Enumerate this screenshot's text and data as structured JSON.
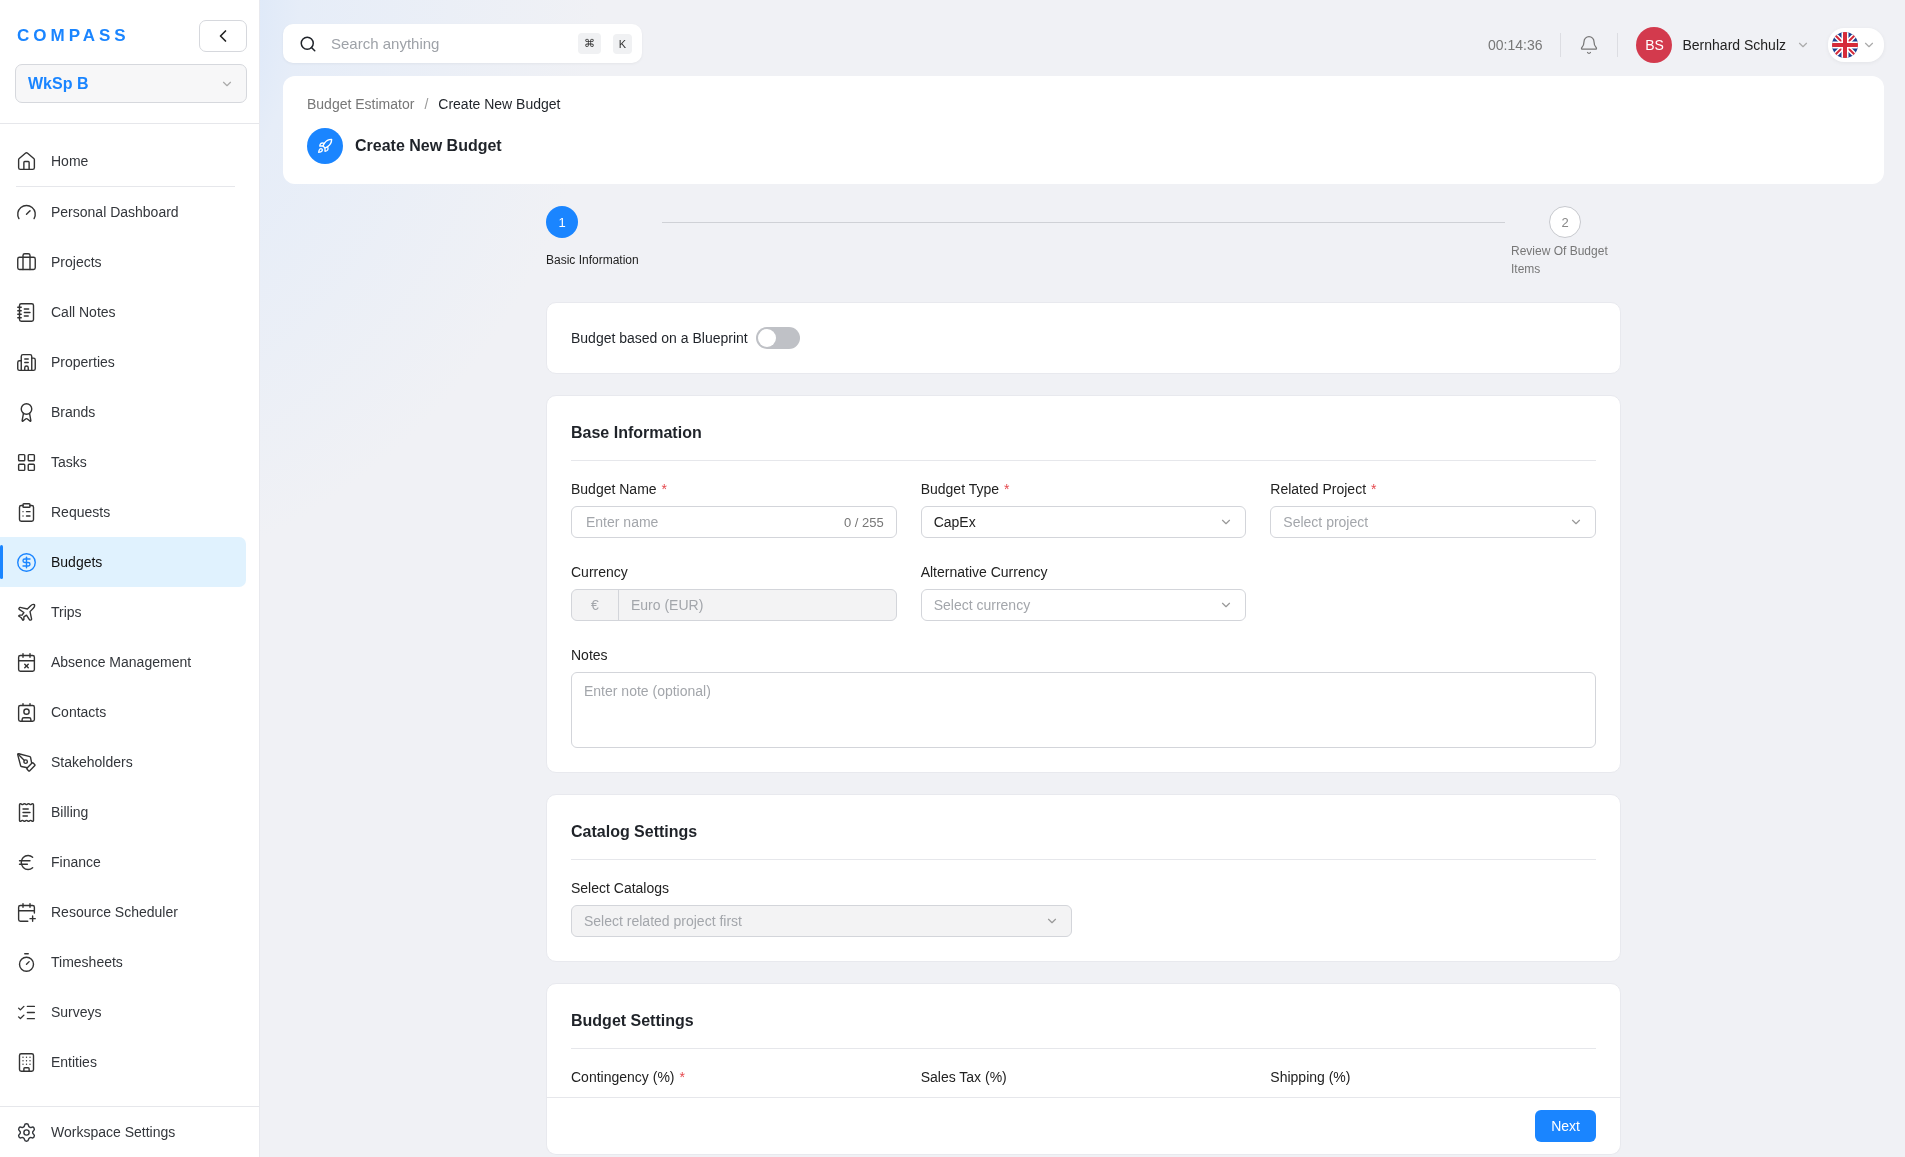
{
  "brand": {
    "logo": "COMPASS"
  },
  "workspace": {
    "value": "WkSp B"
  },
  "sidebar": {
    "items": [
      {
        "label": "Home",
        "selected": false
      },
      {
        "label": "Personal Dashboard",
        "selected": false
      },
      {
        "label": "Projects",
        "selected": false
      },
      {
        "label": "Call Notes",
        "selected": false
      },
      {
        "label": "Properties",
        "selected": false
      },
      {
        "label": "Brands",
        "selected": false
      },
      {
        "label": "Tasks",
        "selected": false
      },
      {
        "label": "Requests",
        "selected": false
      },
      {
        "label": "Budgets",
        "selected": true
      },
      {
        "label": "Trips",
        "selected": false
      },
      {
        "label": "Absence Management",
        "selected": false
      },
      {
        "label": "Contacts",
        "selected": false
      },
      {
        "label": "Stakeholders",
        "selected": false
      },
      {
        "label": "Billing",
        "selected": false
      },
      {
        "label": "Finance",
        "selected": false
      },
      {
        "label": "Resource Scheduler",
        "selected": false
      },
      {
        "label": "Timesheets",
        "selected": false
      },
      {
        "label": "Surveys",
        "selected": false
      },
      {
        "label": "Entities",
        "selected": false
      }
    ],
    "footer_item": {
      "label": "Workspace Settings"
    }
  },
  "search": {
    "placeholder": "Search anything",
    "shortcut": [
      "⌘",
      "K"
    ]
  },
  "timer": "00:14:36",
  "user": {
    "initials": "BS",
    "name": "Bernhard Schulz"
  },
  "breadcrumb": [
    "Budget Estimator",
    "Create New Budget"
  ],
  "breadcrumb_separator": "/",
  "page_title": "Create New Budget",
  "stepper": [
    {
      "number": "1",
      "label": "Basic Information",
      "selected": true
    },
    {
      "number": "2",
      "label": "Review Of Budget Items",
      "selected": false
    }
  ],
  "blueprint": {
    "label": "Budget based on a Blueprint",
    "on": false
  },
  "sections": [
    {
      "title": "Base Information",
      "fields": [
        {
          "kind": "text",
          "label": "Budget Name",
          "required_mark": "*",
          "placeholder": "Enter name",
          "counter": "0 / 255"
        },
        {
          "kind": "select",
          "label": "Budget Type",
          "required_mark": "*",
          "value": "CapEx"
        },
        {
          "kind": "select",
          "label": "Related Project",
          "required_mark": "*",
          "placeholder": "Select project"
        },
        {
          "kind": "currency",
          "label": "Currency",
          "prefix": "€",
          "value": "Euro (EUR)",
          "disabled": true
        },
        {
          "kind": "select",
          "label": "Alternative Currency",
          "placeholder": "Select currency"
        },
        {
          "kind": "textarea",
          "label": "Notes",
          "placeholder": "Enter note (optional)"
        }
      ]
    },
    {
      "title": "Catalog Settings",
      "fields": [
        {
          "kind": "multiselect",
          "label": "Select Catalogs",
          "placeholder": "Select related project first",
          "disabled": true
        }
      ]
    },
    {
      "title": "Budget Settings",
      "fields": [
        {
          "kind": "number",
          "label": "Contingency (%)",
          "required_mark": "*"
        },
        {
          "kind": "number",
          "label": "Sales Tax (%)"
        },
        {
          "kind": "number",
          "label": "Shipping (%)"
        }
      ]
    }
  ],
  "footer": {
    "next": "Next"
  }
}
